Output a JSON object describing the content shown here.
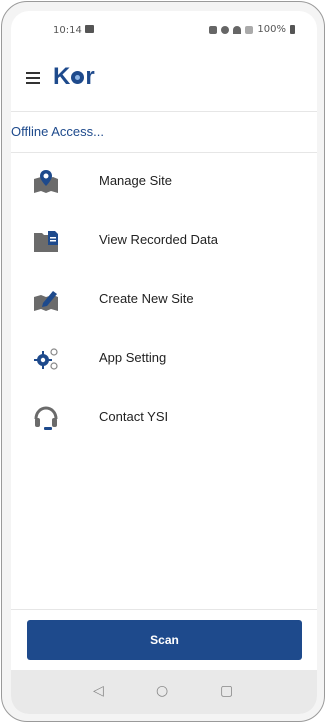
{
  "status_bar": {
    "time": "10:14",
    "battery": "100%"
  },
  "app": {
    "logo_text_1": "K",
    "logo_text_2": "r"
  },
  "offline_label": "Offline Access...",
  "menu": [
    {
      "label": "Manage Site",
      "icon": "map-pin-icon"
    },
    {
      "label": "View Recorded Data",
      "icon": "folder-document-icon"
    },
    {
      "label": "Create New Site",
      "icon": "edit-map-icon"
    },
    {
      "label": "App Setting",
      "icon": "gears-icon"
    },
    {
      "label": "Contact YSI",
      "icon": "headset-icon"
    }
  ],
  "scan_label": "Scan",
  "colors": {
    "brand": "#1e4a8c",
    "icon": "#555555"
  }
}
